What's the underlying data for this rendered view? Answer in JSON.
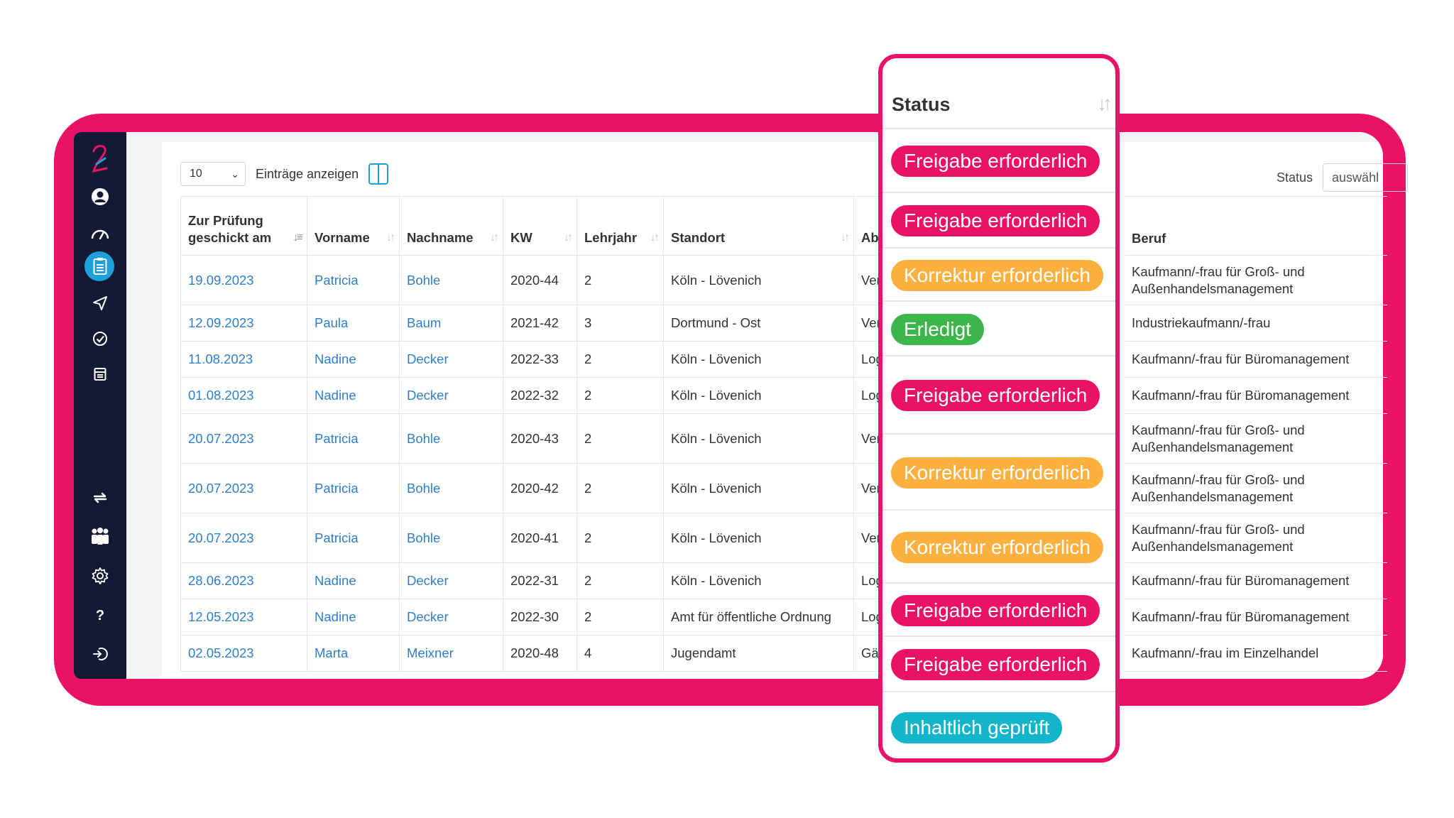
{
  "toolbar": {
    "page_size": "10",
    "entries_label": "Einträge anzeigen"
  },
  "filter": {
    "label": "Status",
    "placeholder": "auswähl"
  },
  "table": {
    "headers": {
      "date": "Zur Prüfung geschickt am",
      "first": "Vorname",
      "last": "Nachname",
      "kw": "KW",
      "year": "Lehrjahr",
      "site": "Standort",
      "dept": "Abt",
      "job": "Beruf"
    },
    "rows": [
      {
        "date": "19.09.2023",
        "first": "Patricia",
        "last": "Bohle",
        "kw": "2020-44",
        "year": "2",
        "site": "Köln - Lövenich",
        "dept": "Ver",
        "job": "Kaufmann/-frau für Groß- und Außenhandelsmanagement"
      },
      {
        "date": "12.09.2023",
        "first": "Paula",
        "last": "Baum",
        "kw": "2021-42",
        "year": "3",
        "site": "Dortmund - Ost",
        "dept": "Ver",
        "job": "Industriekaufmann/-frau"
      },
      {
        "date": "11.08.2023",
        "first": "Nadine",
        "last": "Decker",
        "kw": "2022-33",
        "year": "2",
        "site": "Köln - Lövenich",
        "dept": "Log",
        "job": "Kaufmann/-frau für Büromanagement"
      },
      {
        "date": "01.08.2023",
        "first": "Nadine",
        "last": "Decker",
        "kw": "2022-32",
        "year": "2",
        "site": "Köln - Lövenich",
        "dept": "Log",
        "job": "Kaufmann/-frau für Büromanagement"
      },
      {
        "date": "20.07.2023",
        "first": "Patricia",
        "last": "Bohle",
        "kw": "2020-43",
        "year": "2",
        "site": "Köln - Lövenich",
        "dept": "Ver",
        "job": "Kaufmann/-frau für Groß- und Außenhandelsmanagement"
      },
      {
        "date": "20.07.2023",
        "first": "Patricia",
        "last": "Bohle",
        "kw": "2020-42",
        "year": "2",
        "site": "Köln - Lövenich",
        "dept": "Ver",
        "job": "Kaufmann/-frau für Groß- und Außenhandelsmanagement"
      },
      {
        "date": "20.07.2023",
        "first": "Patricia",
        "last": "Bohle",
        "kw": "2020-41",
        "year": "2",
        "site": "Köln - Lövenich",
        "dept": "Ver",
        "job": "Kaufmann/-frau für Groß- und Außenhandelsmanagement"
      },
      {
        "date": "28.06.2023",
        "first": "Nadine",
        "last": "Decker",
        "kw": "2022-31",
        "year": "2",
        "site": "Köln - Lövenich",
        "dept": "Log",
        "job": "Kaufmann/-frau für Büromanagement"
      },
      {
        "date": "12.05.2023",
        "first": "Nadine",
        "last": "Decker",
        "kw": "2022-30",
        "year": "2",
        "site": "Amt für öffentliche Ordnung",
        "dept": "Log",
        "job": "Kaufmann/-frau für Büromanagement"
      },
      {
        "date": "02.05.2023",
        "first": "Marta",
        "last": "Meixner",
        "kw": "2020-48",
        "year": "4",
        "site": "Jugendamt",
        "dept": "Gär",
        "job": "Kaufmann/-frau im Einzelhandel"
      }
    ]
  },
  "status": {
    "title": "Status",
    "items": [
      {
        "label": "Freigabe erforderlich",
        "color": "#ea1266"
      },
      {
        "label": "Freigabe erforderlich",
        "color": "#ea1266"
      },
      {
        "label": "Korrektur erforderlich",
        "color": "#fbb040"
      },
      {
        "label": "Erledigt",
        "color": "#3cb54a"
      },
      {
        "label": "Freigabe erforderlich",
        "color": "#ea1266"
      },
      {
        "label": "Korrektur erforderlich",
        "color": "#fbb040"
      },
      {
        "label": "Korrektur erforderlich",
        "color": "#fbb040"
      },
      {
        "label": "Freigabe erforderlich",
        "color": "#ea1266"
      },
      {
        "label": "Freigabe erforderlich",
        "color": "#ea1266"
      },
      {
        "label": "Inhaltlich geprüft",
        "color": "#12b5c9"
      }
    ]
  },
  "icons": [
    "logo-icon",
    "user-icon",
    "dashboard-icon",
    "reports-icon",
    "send-icon",
    "check-icon",
    "calendar-icon",
    "sync-icon",
    "team-icon",
    "settings-icon",
    "help-icon",
    "logout-icon"
  ]
}
